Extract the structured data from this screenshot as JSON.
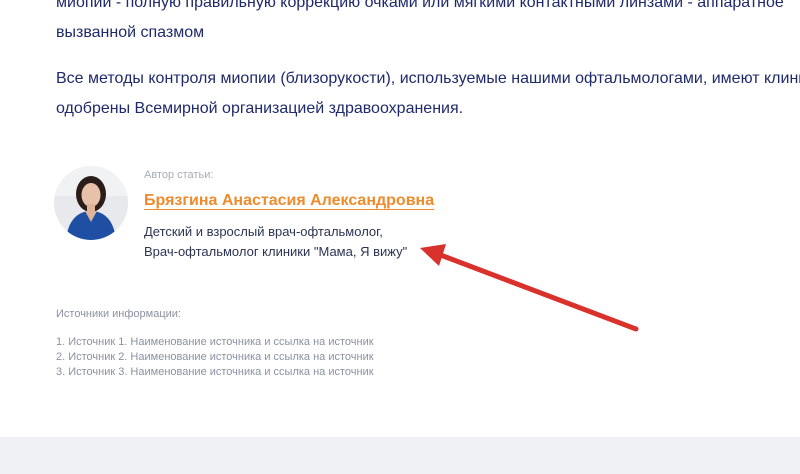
{
  "article": {
    "paragraph1_line1": "миопии - полную правильную коррекцию очками или мягкими контактными линзами - аппаратное",
    "paragraph1_line2": "вызванной спазмом",
    "paragraph2_line1": "Все методы контроля миопии (близорукости), используемые нашими офтальмологами, имеют клини",
    "paragraph2_line2": "одобрены Всемирной организацией здравоохранения."
  },
  "author": {
    "caption": "Автор статьи:",
    "name": "Брязгина Анастасия Александровна",
    "role_line1": "Детский и взрослый врач-офтальмолог,",
    "role_line2": "Врач-офтальмолог клиники \"Мама, Я вижу\""
  },
  "sources": {
    "title": "Источники информации:",
    "items": [
      {
        "num": "1.",
        "text": "Источник 1. Наименование источника и ссылка на источник"
      },
      {
        "num": "2.",
        "text": "Источник 2. Наименование источника и ссылка на источник"
      },
      {
        "num": "3.",
        "text": "Источник 3. Наименование источника и ссылка на источник"
      }
    ]
  },
  "colors": {
    "text": "#1f2a6b",
    "author_name": "#ee8b2c",
    "annotation_arrow": "#d9312c",
    "footer": "#eef0f4"
  }
}
